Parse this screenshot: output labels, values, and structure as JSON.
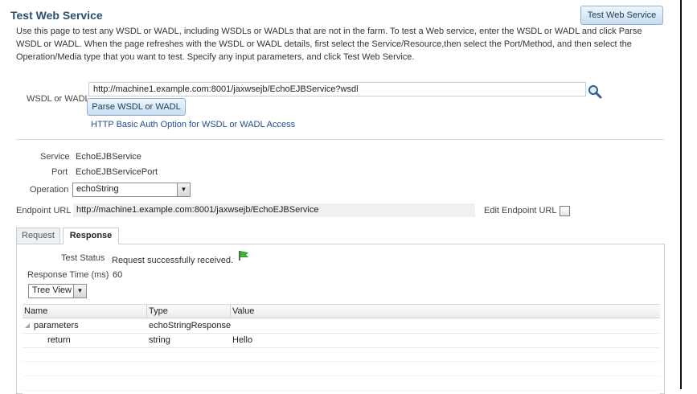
{
  "page": {
    "title": "Test Web Service",
    "top_button": "Test Web Service",
    "intro": "Use this page to test any WSDL or WADL, including WSDLs or WADLs that are not in the farm. To test a Web service, enter the WSDL or WADL and click Parse WSDL or WADL. When the page refreshes with the WSDL or WADL details, first select the Service/Resource,then select the Port/Method, and then select the Operation/Media type that you want to test. Specify any input parameters, and click Test Web Service."
  },
  "wsdl": {
    "label": "WSDL or WADL",
    "value": "http://machine1.example.com:8001/jaxwsejb/EchoEJBService?wsdl",
    "parse_button": "Parse WSDL or WADL",
    "auth_link": "HTTP Basic Auth Option for WSDL or WADL Access",
    "search_icon": "magnifier-search-icon"
  },
  "details": {
    "service_label": "Service",
    "service_value": "EchoEJBService",
    "port_label": "Port",
    "port_value": "EchoEJBServicePort",
    "operation_label": "Operation",
    "operation_value": "echoString",
    "endpoint_label": "Endpoint URL",
    "endpoint_value": "http://machine1.example.com:8001/jaxwsejb/EchoEJBService",
    "edit_endpoint_label": "Edit Endpoint URL",
    "edit_endpoint_checked": false
  },
  "tabs": [
    {
      "label": "Request",
      "selected": false
    },
    {
      "label": "Response",
      "selected": true
    }
  ],
  "response": {
    "status_label": "Test Status",
    "status_value": "Request successfully received.",
    "status_icon": "green-flag-icon",
    "time_label": "Response Time (ms)",
    "time_value": "60",
    "view_select": "Tree View",
    "columns": [
      "Name",
      "Type",
      "Value"
    ],
    "rows": [
      {
        "name": "parameters",
        "type": "echoStringResponse",
        "value": ""
      },
      {
        "name": "return",
        "type": "string",
        "value": "Hello"
      }
    ]
  },
  "colors": {
    "title": "#2b4f72",
    "link": "#1f4f8a",
    "button_border": "#8fb2d4",
    "status_flag": "#3cbf2f"
  }
}
